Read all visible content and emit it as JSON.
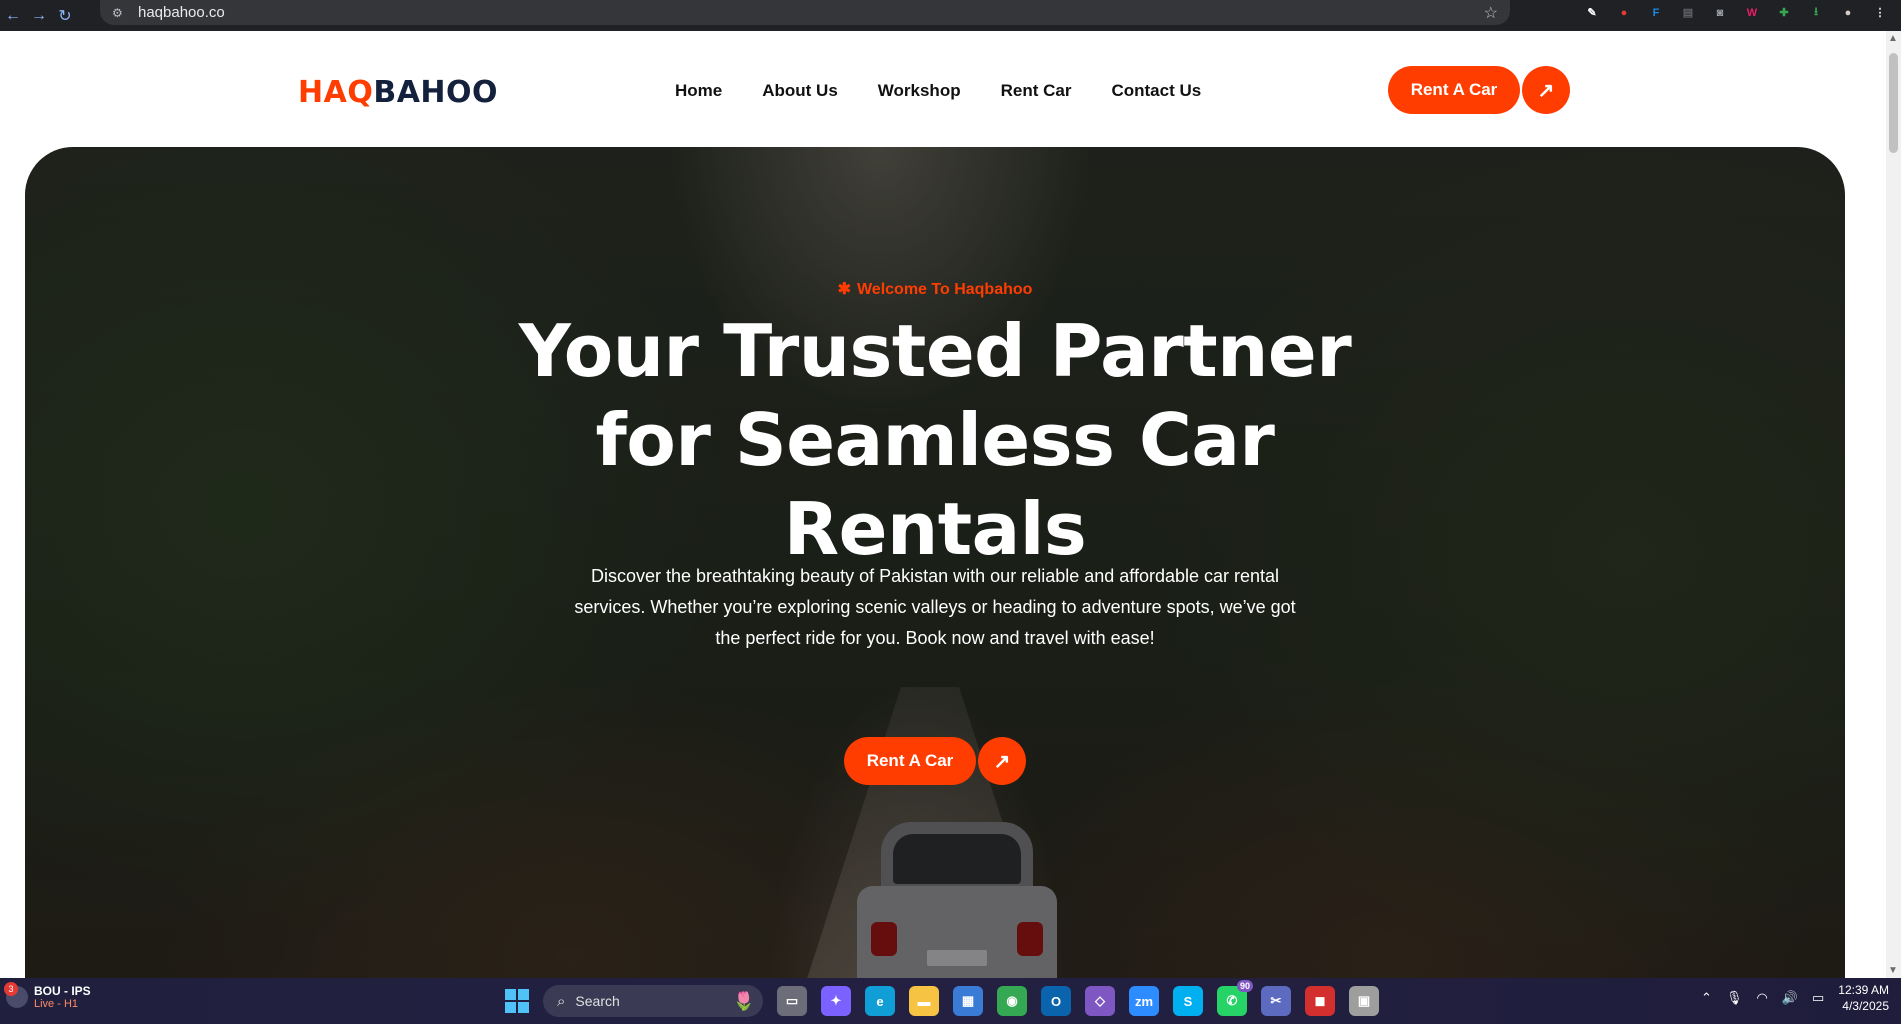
{
  "browser": {
    "url": "haqbahoo.co",
    "extension_icons": [
      {
        "name": "eyedropper-icon",
        "color": "#ffffff",
        "glyph": "✎"
      },
      {
        "name": "shield-extension-icon",
        "color": "#e53935",
        "glyph": "●"
      },
      {
        "name": "fi-extension-icon",
        "color": "#1e88e5",
        "glyph": "F"
      },
      {
        "name": "printer-extension-icon",
        "color": "#5f6368",
        "glyph": "▤"
      },
      {
        "name": "camera-extension-icon",
        "color": "#9aa0a6",
        "glyph": "◙"
      },
      {
        "name": "w-extension-icon",
        "color": "#e91e63",
        "glyph": "W"
      },
      {
        "name": "puzzle-extension-icon",
        "color": "#34a853",
        "glyph": "✚"
      },
      {
        "name": "download-icon",
        "color": "#34a853",
        "glyph": "⭳"
      },
      {
        "name": "profile-avatar-icon",
        "color": "#d7ccc8",
        "glyph": "●"
      },
      {
        "name": "menu-kebab-icon",
        "color": "#e8eaed",
        "glyph": "⋮"
      }
    ]
  },
  "site": {
    "logo_part1": "HAQ",
    "logo_part2": "BAHOO",
    "brand_color": "#ff3d00",
    "nav": [
      "Home",
      "About Us",
      "Workshop",
      "Rent Car",
      "Contact Us"
    ],
    "header_cta": "Rent A Car"
  },
  "hero": {
    "eyebrow": "Welcome To Haqbahoo",
    "title": "Your Trusted Partner for Seamless Car Rentals",
    "description": "Discover the breathtaking beauty of Pakistan with our reliable and affordable car rental services. Whether you’re exploring scenic valleys or heading to adventure spots, we’ve got the perfect ride for you. Book now and travel with ease!",
    "cta": "Rent A Car"
  },
  "taskbar": {
    "status_title": "BOU - IPS",
    "status_sub": "Live - H1",
    "status_badge": "3",
    "search_placeholder": "Search",
    "apps": [
      {
        "name": "file-explorer-icon",
        "color": "#6d6d7a",
        "glyph": "▭",
        "badge": ""
      },
      {
        "name": "copilot-icon",
        "color": "#7b61ff",
        "glyph": "✦",
        "badge": ""
      },
      {
        "name": "edge-icon",
        "color": "#0f9ed5",
        "glyph": "e",
        "badge": ""
      },
      {
        "name": "folder-icon",
        "color": "#f6c343",
        "glyph": "▬",
        "badge": ""
      },
      {
        "name": "store-icon",
        "color": "#3a7bd5",
        "glyph": "▦",
        "badge": ""
      },
      {
        "name": "chrome-icon",
        "color": "#34a853",
        "glyph": "◉",
        "badge": ""
      },
      {
        "name": "outlook-icon",
        "color": "#0a64ad",
        "glyph": "O",
        "badge": ""
      },
      {
        "name": "visual-studio-icon",
        "color": "#7e57c2",
        "glyph": "◇",
        "badge": ""
      },
      {
        "name": "zoom-icon",
        "color": "#2d8cff",
        "glyph": "zm",
        "badge": ""
      },
      {
        "name": "skype-icon",
        "color": "#00aff0",
        "glyph": "S",
        "badge": ""
      },
      {
        "name": "whatsapp-icon",
        "color": "#25d366",
        "glyph": "✆",
        "badge": "90"
      },
      {
        "name": "snipping-tool-icon",
        "color": "#5c6bc0",
        "glyph": "✂",
        "badge": ""
      },
      {
        "name": "recorder-icon",
        "color": "#d32f2f",
        "glyph": "◼",
        "badge": ""
      },
      {
        "name": "app-icon",
        "color": "#9e9e9e",
        "glyph": "▣",
        "badge": ""
      }
    ],
    "time": "12:39 AM",
    "date": "4/3/2025"
  }
}
